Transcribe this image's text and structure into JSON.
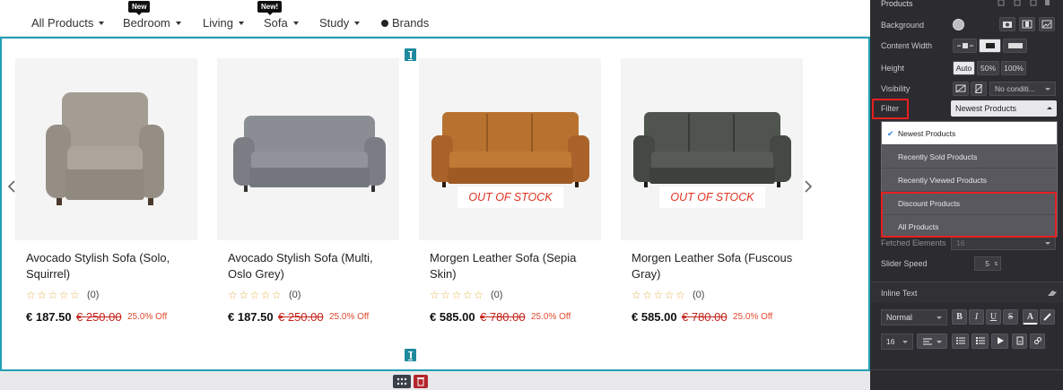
{
  "nav": {
    "items": [
      {
        "label": "All Products",
        "badge": ""
      },
      {
        "label": "Bedroom",
        "badge": "New"
      },
      {
        "label": "Living",
        "badge": ""
      },
      {
        "label": "Sofa",
        "badge": "New!"
      },
      {
        "label": "Study",
        "badge": ""
      }
    ],
    "brands_label": "Brands"
  },
  "products": [
    {
      "name": "Avocado Stylish Sofa (Solo, Squirrel)",
      "rating_count": "(0)",
      "price": "€ 187.50",
      "old_price": "€ 250.00",
      "discount": "25.0% Off",
      "stock_label": "",
      "stars": "☆☆☆☆☆"
    },
    {
      "name": "Avocado Stylish Sofa (Multi, Oslo Grey)",
      "rating_count": "(0)",
      "price": "€ 187.50",
      "old_price": "€ 250.00",
      "discount": "25.0% Off",
      "stock_label": "",
      "stars": "☆☆☆☆☆"
    },
    {
      "name": "Morgen Leather Sofa (Sepia Skin)",
      "rating_count": "(0)",
      "price": "€ 585.00",
      "old_price": "€ 780.00",
      "discount": "25.0% Off",
      "stock_label": "OUT OF STOCK",
      "stars": "☆☆☆☆☆"
    },
    {
      "name": "Morgen Leather Sofa (Fuscous Gray)",
      "rating_count": "(0)",
      "price": "€ 585.00",
      "old_price": "€ 780.00",
      "discount": "25.0% Off",
      "stock_label": "OUT OF STOCK",
      "stars": "☆☆☆☆☆"
    }
  ],
  "colors": {
    "accent": "#21a0b5",
    "sale_red": "#c4221b",
    "chair": "#9a948b",
    "grey_sofa": "#7b7f86",
    "sepia_sofa": "#b0672d",
    "fuscous_sofa": "#4b4f4c"
  },
  "panel": {
    "title": "Products",
    "background_label": "Background",
    "content_width_label": "Content Width",
    "height_label": "Height",
    "height_options": [
      "Auto",
      "50%",
      "100%"
    ],
    "visibility_label": "Visibility",
    "visibility_value": "No conditi...",
    "filter_label": "Filter",
    "filter_value": "Newest Products",
    "filter_options": [
      "Newest Products",
      "Recently Sold Products",
      "Recently Viewed Products",
      "Discount Products",
      "All Products"
    ],
    "fetched_label": "Fetched Elements",
    "fetched_value": "16",
    "slider_speed_label": "Slider Speed",
    "slider_speed_value": "5",
    "slider_speed_unit": "s",
    "inline_text_label": "Inline Text",
    "style_value": "Normal",
    "font_size_value": "16",
    "format_buttons": [
      "B",
      "I",
      "U",
      "S",
      "A"
    ]
  }
}
